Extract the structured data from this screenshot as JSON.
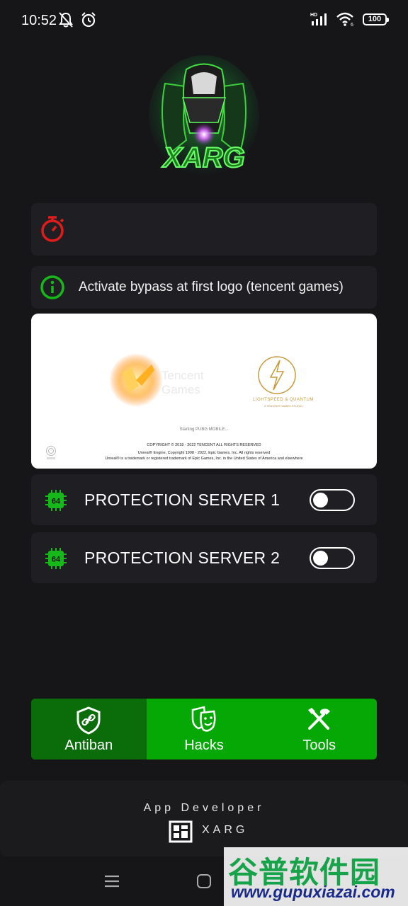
{
  "status_bar": {
    "time": "10:52",
    "battery": "100",
    "network": "HD"
  },
  "info": {
    "text": "Activate bypass at first logo (tencent games)"
  },
  "splash": {
    "tencent_text": "Tencent Games",
    "lightspeed_text": "LIGHTSPEED & QUANTUM",
    "lightspeed_sub": "A TENCENT GAMES STUDIO",
    "starting_text": "Starting PUBG MOBILE...",
    "copyright_1": "COPYRIGHT © 2018 - 2022 TENCENT ALL RIGHTS RESERVED",
    "copyright_2": "Unreal® Engine, Copyright 1998 - 2022, Epic Games, Inc.  All rights reserved",
    "copyright_3": "Unreal® is a trademark or registered trademark of Epic Games, Inc. in the United States of America and elsewhere"
  },
  "servers": [
    {
      "label": "PROTECTION SERVER 1",
      "chip": "64",
      "enabled": false
    },
    {
      "label": "PROTECTION SERVER 2",
      "chip": "64",
      "enabled": false
    }
  ],
  "tabs": [
    {
      "label": "Antiban",
      "icon": "shield-link-icon",
      "active": true
    },
    {
      "label": "Hacks",
      "icon": "mask-icon",
      "active": false
    },
    {
      "label": "Tools",
      "icon": "tools-icon",
      "active": false
    }
  ],
  "developer": {
    "title": "App Developer",
    "name": "XARG"
  },
  "watermark": {
    "cn": "谷普软件园",
    "url": "www.gupuxiazai.com"
  },
  "colors": {
    "accent_green": "#06a806",
    "active_tab": "#0a6d0a",
    "timer_red": "#e01b1b",
    "info_green": "#17b81a"
  }
}
